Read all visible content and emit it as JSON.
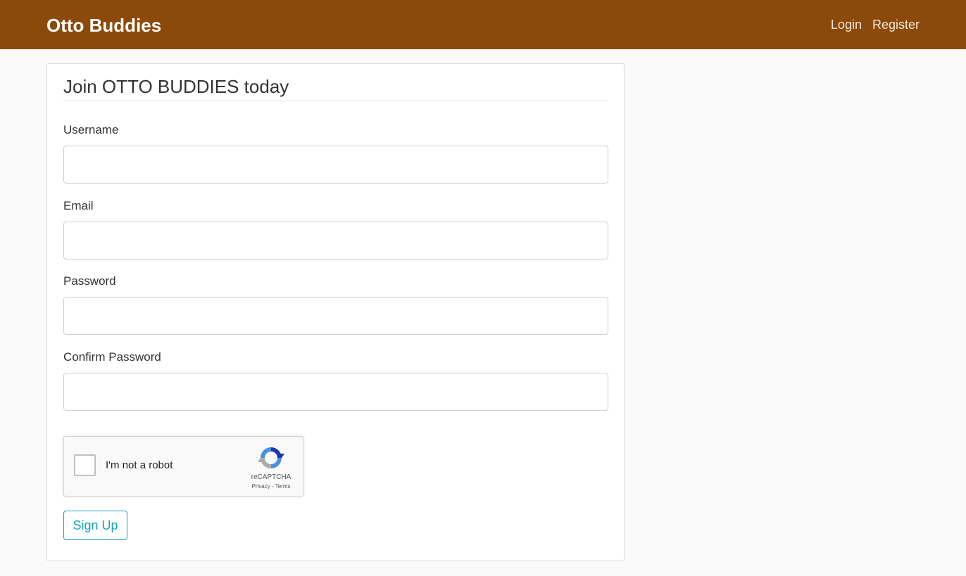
{
  "nav": {
    "brand": "Otto Buddies",
    "links": [
      "Login",
      "Register"
    ]
  },
  "form": {
    "legend": "Join OTTO BUDDIES today",
    "fields": [
      {
        "label": "Username",
        "value": "",
        "placeholder": ""
      },
      {
        "label": "Email",
        "value": "",
        "placeholder": ""
      },
      {
        "label": "Password",
        "value": "",
        "placeholder": ""
      },
      {
        "label": "Confirm Password",
        "value": "",
        "placeholder": ""
      }
    ],
    "recaptcha": {
      "label": "I'm not a robot",
      "brand": "reCAPTCHA",
      "privacy": "Privacy",
      "separator": " - ",
      "terms": "Terms",
      "icon": "recaptcha-logo"
    },
    "submit_label": "Sign Up"
  },
  "colors": {
    "navbar": "#8b4a0a",
    "accent": "#17a2b8"
  }
}
